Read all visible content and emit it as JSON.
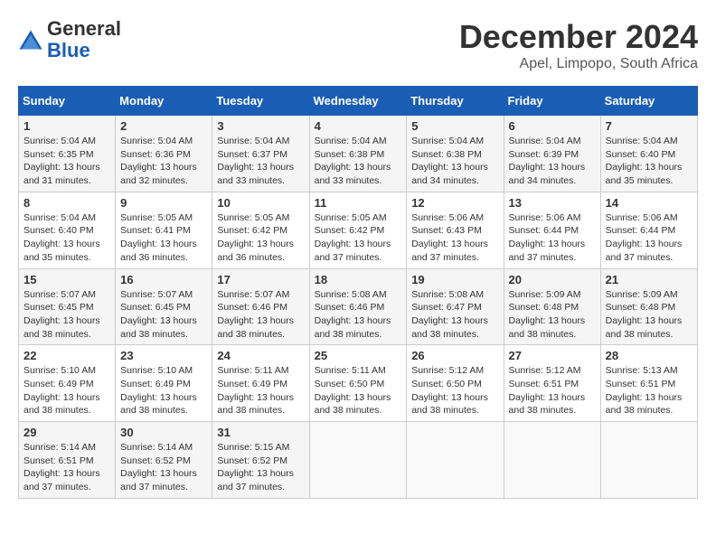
{
  "logo": {
    "general": "General",
    "blue": "Blue"
  },
  "title": {
    "month": "December 2024",
    "location": "Apel, Limpopo, South Africa"
  },
  "headers": [
    "Sunday",
    "Monday",
    "Tuesday",
    "Wednesday",
    "Thursday",
    "Friday",
    "Saturday"
  ],
  "weeks": [
    [
      {
        "day": "1",
        "sunrise": "5:04 AM",
        "sunset": "6:35 PM",
        "daylight": "13 hours and 31 minutes."
      },
      {
        "day": "2",
        "sunrise": "5:04 AM",
        "sunset": "6:36 PM",
        "daylight": "13 hours and 32 minutes."
      },
      {
        "day": "3",
        "sunrise": "5:04 AM",
        "sunset": "6:37 PM",
        "daylight": "13 hours and 33 minutes."
      },
      {
        "day": "4",
        "sunrise": "5:04 AM",
        "sunset": "6:38 PM",
        "daylight": "13 hours and 33 minutes."
      },
      {
        "day": "5",
        "sunrise": "5:04 AM",
        "sunset": "6:38 PM",
        "daylight": "13 hours and 34 minutes."
      },
      {
        "day": "6",
        "sunrise": "5:04 AM",
        "sunset": "6:39 PM",
        "daylight": "13 hours and 34 minutes."
      },
      {
        "day": "7",
        "sunrise": "5:04 AM",
        "sunset": "6:40 PM",
        "daylight": "13 hours and 35 minutes."
      }
    ],
    [
      {
        "day": "8",
        "sunrise": "5:04 AM",
        "sunset": "6:40 PM",
        "daylight": "13 hours and 35 minutes."
      },
      {
        "day": "9",
        "sunrise": "5:05 AM",
        "sunset": "6:41 PM",
        "daylight": "13 hours and 36 minutes."
      },
      {
        "day": "10",
        "sunrise": "5:05 AM",
        "sunset": "6:42 PM",
        "daylight": "13 hours and 36 minutes."
      },
      {
        "day": "11",
        "sunrise": "5:05 AM",
        "sunset": "6:42 PM",
        "daylight": "13 hours and 37 minutes."
      },
      {
        "day": "12",
        "sunrise": "5:06 AM",
        "sunset": "6:43 PM",
        "daylight": "13 hours and 37 minutes."
      },
      {
        "day": "13",
        "sunrise": "5:06 AM",
        "sunset": "6:44 PM",
        "daylight": "13 hours and 37 minutes."
      },
      {
        "day": "14",
        "sunrise": "5:06 AM",
        "sunset": "6:44 PM",
        "daylight": "13 hours and 37 minutes."
      }
    ],
    [
      {
        "day": "15",
        "sunrise": "5:07 AM",
        "sunset": "6:45 PM",
        "daylight": "13 hours and 38 minutes."
      },
      {
        "day": "16",
        "sunrise": "5:07 AM",
        "sunset": "6:45 PM",
        "daylight": "13 hours and 38 minutes."
      },
      {
        "day": "17",
        "sunrise": "5:07 AM",
        "sunset": "6:46 PM",
        "daylight": "13 hours and 38 minutes."
      },
      {
        "day": "18",
        "sunrise": "5:08 AM",
        "sunset": "6:46 PM",
        "daylight": "13 hours and 38 minutes."
      },
      {
        "day": "19",
        "sunrise": "5:08 AM",
        "sunset": "6:47 PM",
        "daylight": "13 hours and 38 minutes."
      },
      {
        "day": "20",
        "sunrise": "5:09 AM",
        "sunset": "6:48 PM",
        "daylight": "13 hours and 38 minutes."
      },
      {
        "day": "21",
        "sunrise": "5:09 AM",
        "sunset": "6:48 PM",
        "daylight": "13 hours and 38 minutes."
      }
    ],
    [
      {
        "day": "22",
        "sunrise": "5:10 AM",
        "sunset": "6:49 PM",
        "daylight": "13 hours and 38 minutes."
      },
      {
        "day": "23",
        "sunrise": "5:10 AM",
        "sunset": "6:49 PM",
        "daylight": "13 hours and 38 minutes."
      },
      {
        "day": "24",
        "sunrise": "5:11 AM",
        "sunset": "6:49 PM",
        "daylight": "13 hours and 38 minutes."
      },
      {
        "day": "25",
        "sunrise": "5:11 AM",
        "sunset": "6:50 PM",
        "daylight": "13 hours and 38 minutes."
      },
      {
        "day": "26",
        "sunrise": "5:12 AM",
        "sunset": "6:50 PM",
        "daylight": "13 hours and 38 minutes."
      },
      {
        "day": "27",
        "sunrise": "5:12 AM",
        "sunset": "6:51 PM",
        "daylight": "13 hours and 38 minutes."
      },
      {
        "day": "28",
        "sunrise": "5:13 AM",
        "sunset": "6:51 PM",
        "daylight": "13 hours and 38 minutes."
      }
    ],
    [
      {
        "day": "29",
        "sunrise": "5:14 AM",
        "sunset": "6:51 PM",
        "daylight": "13 hours and 37 minutes."
      },
      {
        "day": "30",
        "sunrise": "5:14 AM",
        "sunset": "6:52 PM",
        "daylight": "13 hours and 37 minutes."
      },
      {
        "day": "31",
        "sunrise": "5:15 AM",
        "sunset": "6:52 PM",
        "daylight": "13 hours and 37 minutes."
      },
      null,
      null,
      null,
      null
    ]
  ]
}
